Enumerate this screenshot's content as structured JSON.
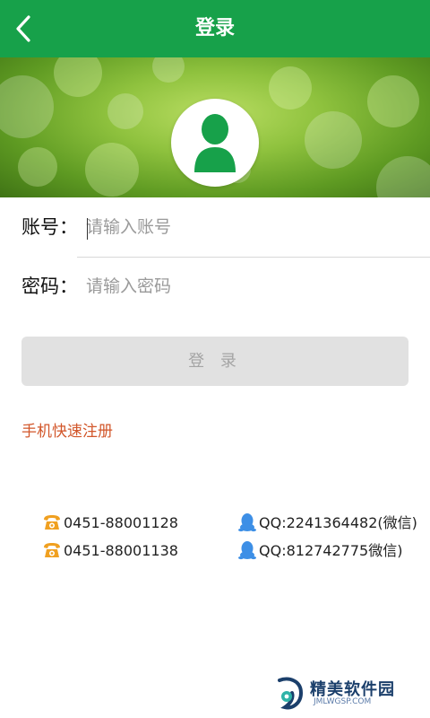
{
  "header": {
    "title": "登录",
    "back_icon": "back-arrow-icon",
    "background": "#17a14a"
  },
  "banner": {
    "avatar_icon": "user-avatar-icon",
    "avatar_color": "#17a14a"
  },
  "form": {
    "account_label": "账号：",
    "account_placeholder": "请输入账号",
    "password_label": "密码：",
    "password_placeholder": "请输入密码",
    "login_button": "登 录"
  },
  "register_link": "手机快速注册",
  "contacts": {
    "phones": [
      "0451-88001128",
      "0451-88001138"
    ],
    "qq": [
      "QQ:2241364482(微信)",
      "QQ:812742775微信)"
    ],
    "phone_icon": "telephone-icon",
    "qq_icon": "qq-penguin-icon"
  },
  "watermark": {
    "text": "精美软件园",
    "sub": "JMLWGSP.COM"
  }
}
